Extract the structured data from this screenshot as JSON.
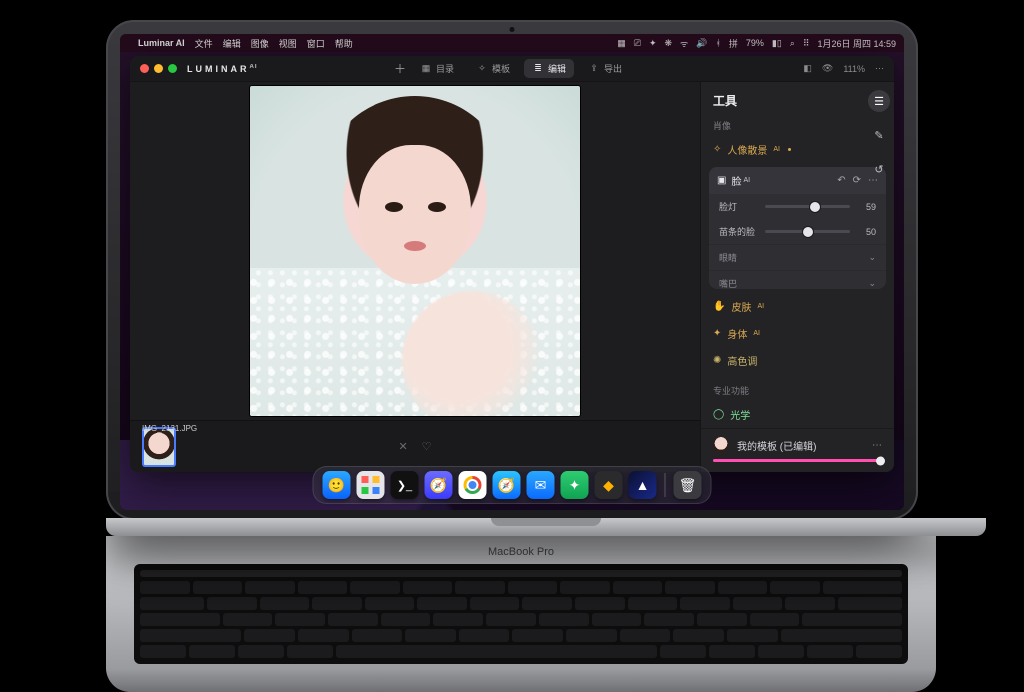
{
  "menubar": {
    "app": "Luminar AI",
    "items": [
      "文件",
      "编辑",
      "图像",
      "视图",
      "窗口",
      "帮助"
    ],
    "status": {
      "battery": "79%",
      "ime": "拼",
      "datetime": "1月26日 周四 14:59"
    }
  },
  "titlebar": {
    "brand": "LUMINAR",
    "brand_suffix": "AI",
    "nav": {
      "catalog": "目录",
      "templates": "模板",
      "edit": "编辑",
      "export": "导出"
    },
    "zoom": "111%"
  },
  "filmstrip": {
    "filename": "IMG_2131.JPG"
  },
  "panel": {
    "title": "工具",
    "section_portrait": "肖像",
    "tool_bokeh": "人像散景",
    "face": {
      "title": "脸",
      "sliders": {
        "facelight": {
          "label": "脸灯",
          "value": 59
        },
        "slim": {
          "label": "苗条的脸",
          "value": 50
        }
      },
      "sub_eyes": "眼睛",
      "sub_mouth": "嘴巴"
    },
    "tool_skin": "皮肤",
    "tool_body": "身体",
    "tool_highkey": "高色调",
    "section_pro": "专业功能",
    "tool_optics": "光学",
    "template": {
      "label": "我的模板 (已编辑)",
      "amount": 100
    }
  },
  "dock": {
    "items": [
      "finder",
      "launchpad",
      "terminal",
      "finder2",
      "chrome",
      "safari",
      "mail",
      "wechat",
      "sketch",
      "luminar",
      "trash"
    ]
  },
  "device": {
    "label": "MacBook Pro"
  }
}
